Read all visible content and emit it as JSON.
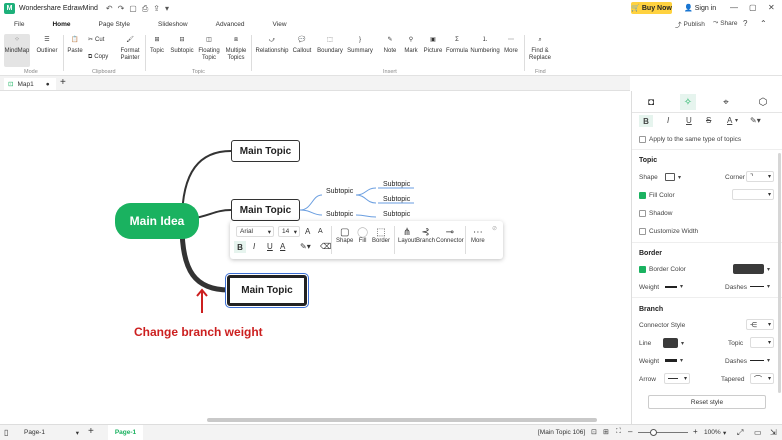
{
  "app": {
    "title": "Wondershare EdrawMind",
    "logo": "M"
  },
  "header": {
    "buy_now": "Buy Now",
    "sign_in": "Sign in",
    "publish": "Publish",
    "share": "Share"
  },
  "menu": [
    "File",
    "Home",
    "Page Style",
    "Slideshow",
    "Advanced",
    "View"
  ],
  "ribbon": {
    "buttons": [
      {
        "label": "MindMap"
      },
      {
        "label": "Outliner"
      },
      {
        "label": "Paste"
      },
      {
        "label": "Cut"
      },
      {
        "label": "Copy"
      },
      {
        "label": "Format Painter"
      },
      {
        "label": "Topic"
      },
      {
        "label": "Subtopic"
      },
      {
        "label": "Floating Topic"
      },
      {
        "label": "Multiple Topics"
      },
      {
        "label": "Relationship"
      },
      {
        "label": "Callout"
      },
      {
        "label": "Boundary"
      },
      {
        "label": "Summary"
      },
      {
        "label": "Note"
      },
      {
        "label": "Mark"
      },
      {
        "label": "Picture"
      },
      {
        "label": "Formula"
      },
      {
        "label": "Numbering"
      },
      {
        "label": "More"
      },
      {
        "label": "Find & Replace"
      }
    ],
    "groups": [
      "Mode",
      "Clipboard",
      "Topic",
      "Insert",
      "Find"
    ]
  },
  "doc_tab": {
    "name": "Map1"
  },
  "canvas": {
    "main_idea": "Main Idea",
    "topics": [
      "Main Topic",
      "Main Topic",
      "Main Topic"
    ],
    "subtopics": [
      "Subtopic",
      "Subtopic",
      "Subtopic",
      "Subtopic",
      "Subtopic"
    ],
    "annotation": "Change branch weight"
  },
  "floatbar": {
    "font": "Arial",
    "size": "14",
    "grow": "A",
    "shrink": "A",
    "bold": "B",
    "italic": "I",
    "underline": "U",
    "color_a": "A",
    "shape": "Shape",
    "fill": "Fill",
    "border": "Border",
    "layout": "Layout",
    "branch": "Branch",
    "connector": "Connector",
    "more": "More"
  },
  "panel": {
    "apply_same": "Apply to the same type of topics",
    "topic_section": "Topic",
    "shape": "Shape",
    "corner": "Corner",
    "fill_color": "Fill Color",
    "shadow": "Shadow",
    "custom_width": "Customize Width",
    "border_section": "Border",
    "border_color": "Border Color",
    "weight": "Weight",
    "dashes": "Dashes",
    "branch_section": "Branch",
    "connector_style": "Connector Style",
    "line": "Line",
    "topic": "Topic",
    "arrow": "Arrow",
    "tapered": "Tapered",
    "reset": "Reset style",
    "fmt": [
      "B",
      "I",
      "U",
      "S",
      "A"
    ]
  },
  "status": {
    "page_select": "Page-1",
    "page_tab": "Page-1",
    "selection": "[Main Topic 106]",
    "zoom": "100%",
    "colors": {
      "accent": "#1ab260",
      "annotation": "#cc1f1f"
    }
  }
}
